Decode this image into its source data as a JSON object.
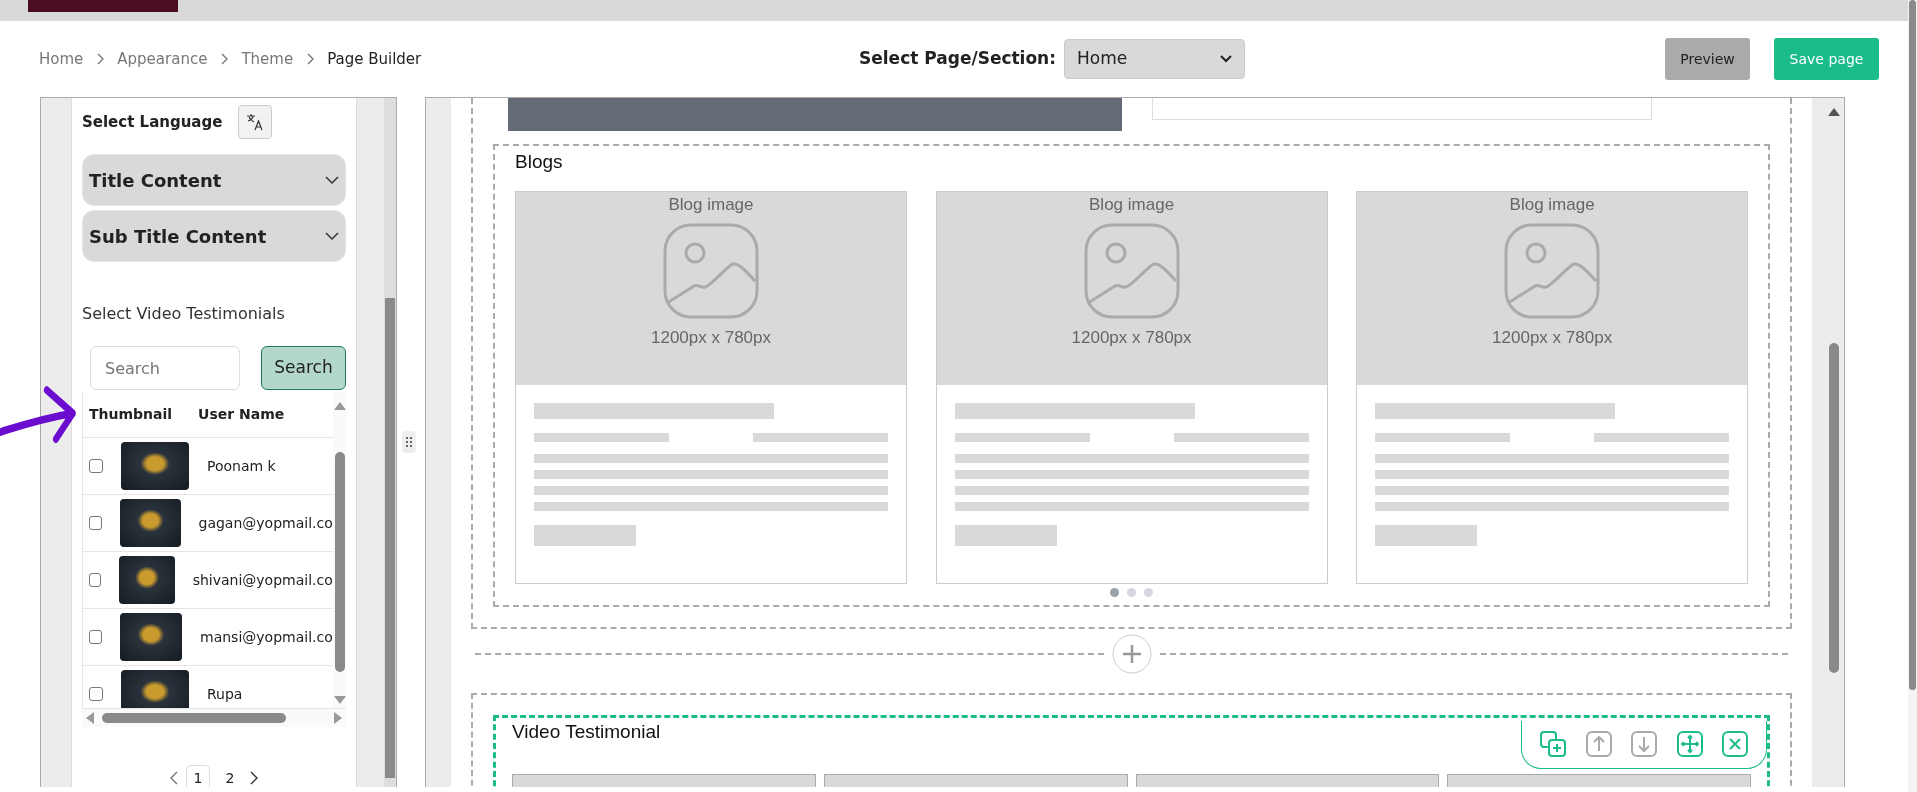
{
  "breadcrumb": [
    {
      "label": "Home",
      "current": false
    },
    {
      "label": "Appearance",
      "current": false
    },
    {
      "label": "Theme",
      "current": false
    },
    {
      "label": "Page Builder",
      "current": true
    }
  ],
  "page_select": {
    "label": "Select Page/Section:",
    "value": "Home"
  },
  "actions": [
    {
      "label": "Preview",
      "kind": "secondary"
    },
    {
      "label": "Save page",
      "kind": "primary"
    }
  ],
  "sidebar": {
    "language_label": "Select Language",
    "accordions": [
      {
        "title": "Title Content",
        "expanded": false
      },
      {
        "title": "Sub Title Content",
        "expanded": false
      }
    ],
    "video_label": "Select Video Testimonials",
    "search": {
      "placeholder": "Search",
      "button": "Search"
    },
    "table": {
      "columns": [
        "Thumbnail",
        "User Name"
      ],
      "rows": [
        {
          "name": "Poonam k",
          "checked": false
        },
        {
          "name": "gagan@yopmail.co",
          "checked": false
        },
        {
          "name": "shivani@yopmail.co",
          "checked": false
        },
        {
          "name": "mansi@yopmail.co",
          "checked": false
        },
        {
          "name": "Rupa",
          "checked": false
        }
      ]
    },
    "pagination": [
      {
        "label": "1",
        "selected": true
      },
      {
        "label": "2",
        "selected": false
      }
    ]
  },
  "canvas": {
    "blogs": {
      "title": "Blogs",
      "cards": [
        {
          "image_label": "Blog image",
          "size": "1200px x 780px"
        },
        {
          "image_label": "Blog image",
          "size": "1200px x 780px"
        },
        {
          "image_label": "Blog image",
          "size": "1200px x 780px"
        }
      ],
      "dots": [
        {
          "selected": true
        },
        {
          "selected": false
        },
        {
          "selected": false
        }
      ]
    },
    "video_testimonial": {
      "title": "Video Testimonial",
      "selected": true
    }
  }
}
